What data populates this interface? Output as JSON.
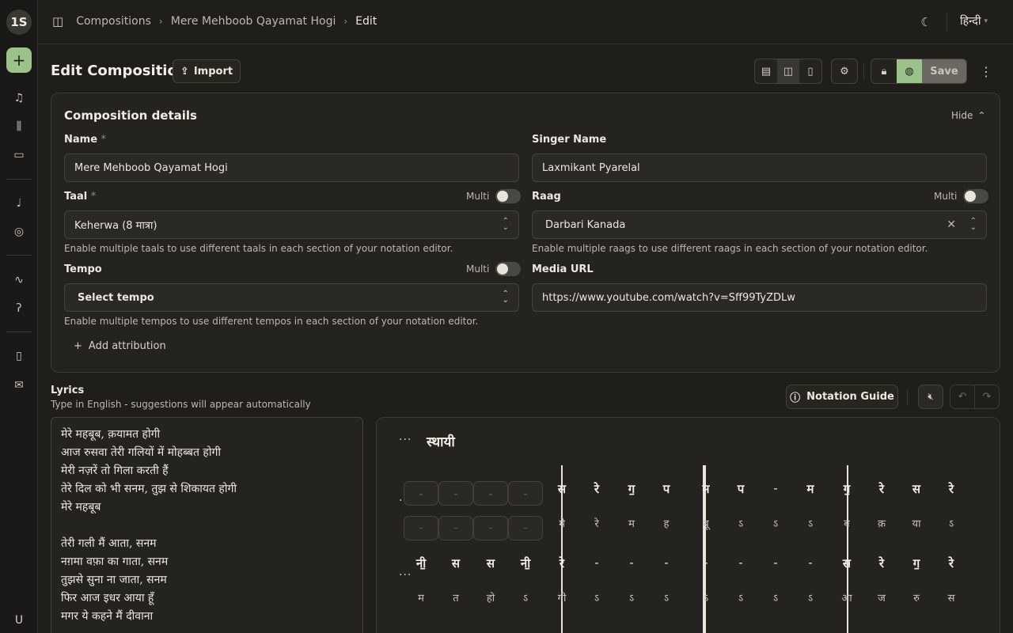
{
  "app": {
    "logo_text": "1S",
    "user_initial": "U"
  },
  "breadcrumb": [
    "Compositions",
    "Mere Mehboob Qayamat Hogi",
    "Edit"
  ],
  "header": {
    "language": "हिन्दी"
  },
  "page": {
    "title": "Edit Composition",
    "import_label": "Import",
    "save_label": "Save"
  },
  "details": {
    "title": "Composition details",
    "hide_label": "Hide",
    "name_label": "Name",
    "name_value": "Mere Mehboob Qayamat Hogi",
    "singer_label": "Singer Name",
    "singer_value": "Laxmikant Pyarelal",
    "taal_label": "Taal",
    "taal_value": "Keherwa (8 मात्रा)",
    "taal_help": "Enable multiple taals to use different taals in each section of your notation editor.",
    "raag_label": "Raag",
    "raag_value": "Darbari Kanada",
    "raag_help": "Enable multiple raags to use different raags in each section of your notation editor.",
    "tempo_label": "Tempo",
    "tempo_placeholder": "Select tempo",
    "tempo_help": "Enable multiple tempos to use different tempos in each section of your notation editor.",
    "media_label": "Media URL",
    "media_value": "https://www.youtube.com/watch?v=Sff99TyZDLw",
    "multi_label": "Multi",
    "add_attribution": "Add attribution",
    "required_mark": "*"
  },
  "lyrics": {
    "title": "Lyrics",
    "help": "Type in English - suggestions will appear automatically",
    "lines": [
      "मेरे महबूब, क़यामत होगी",
      "आज रुसवा तेरी गलियों में मोहब्बत होगी",
      "मेरी नज़रें तो गिला करती हैं",
      "तेरे दिल को भी सनम, तुझ से शिकायत होगी",
      "मेरे महबूब",
      "",
      "तेरी गली मैं आता, सनम",
      "नग़मा वफ़ा का गाता, सनम",
      "तुझसे सुना ना जाता, सनम",
      "फिर आज इधर आया हूँ",
      "मगर ये कहने मैं दीवाना"
    ]
  },
  "toolbar": {
    "notation_guide": "Notation Guide"
  },
  "notation": {
    "section_title": "स्थायी",
    "row1_swaras": [
      "-",
      "-",
      "-",
      "-",
      "स",
      "रे",
      "ग॒",
      "प",
      "म",
      "प",
      "-",
      "म",
      "ग॒",
      "रे",
      "स",
      "रे"
    ],
    "row1_lyrics": [
      "-",
      "-",
      "-",
      "-",
      "मे",
      "रे",
      "म",
      "ह",
      "बू",
      "ऽ",
      "ऽ",
      "ऽ",
      "ब",
      "क़",
      "या",
      "ऽ"
    ],
    "row2_swaras": [
      "नी॒",
      "स",
      "स",
      "नी॒",
      "रे",
      "-",
      "-",
      "-",
      "-",
      "-",
      "-",
      "-",
      "स",
      "रे",
      "ग॒",
      "रे"
    ],
    "row2_lyrics": [
      "म",
      "त",
      "हो",
      "ऽ",
      "गी",
      "ऽ",
      "ऽ",
      "ऽ",
      "ऽ",
      "ऽ",
      "ऽ",
      "ऽ",
      "आ",
      "ज",
      "रु",
      "स"
    ]
  },
  "colors": {
    "accent": "#9bc28a",
    "background": "#1f1e1b",
    "surface": "#24231f"
  }
}
